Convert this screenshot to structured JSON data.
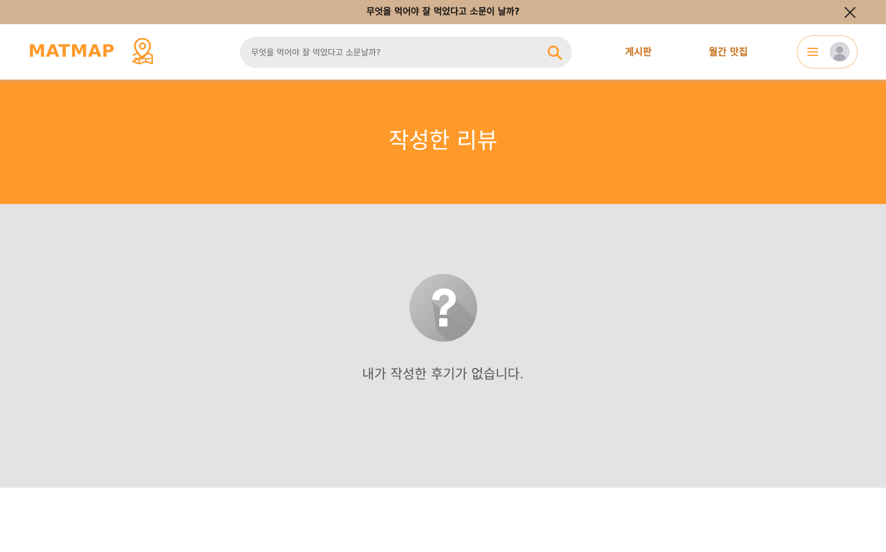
{
  "announcement": {
    "text": "무엇을 먹어야 잘 먹었다고 소문이 날까?",
    "close_icon": "close-icon"
  },
  "header": {
    "logo_text": "MATMAP",
    "logo_icon": "map-pin-icon",
    "search": {
      "placeholder": "무엇을 먹어야 잘 먹었다고 소문날까?",
      "value": "",
      "icon": "search-icon"
    },
    "nav": [
      {
        "label": "게시판"
      },
      {
        "label": "월간 맛집"
      }
    ],
    "user_menu": {
      "menu_icon": "hamburger-icon",
      "avatar_icon": "user-avatar-icon"
    }
  },
  "hero": {
    "title": "작성한 리뷰"
  },
  "empty_state": {
    "icon": "question-icon",
    "message": "내가 작성한 후기가 없습니다."
  },
  "colors": {
    "brand_orange": "#ff9a2a",
    "announce_bg": "#d3b291",
    "nav_text": "#c96d16",
    "content_bg": "#e3e3e3"
  }
}
